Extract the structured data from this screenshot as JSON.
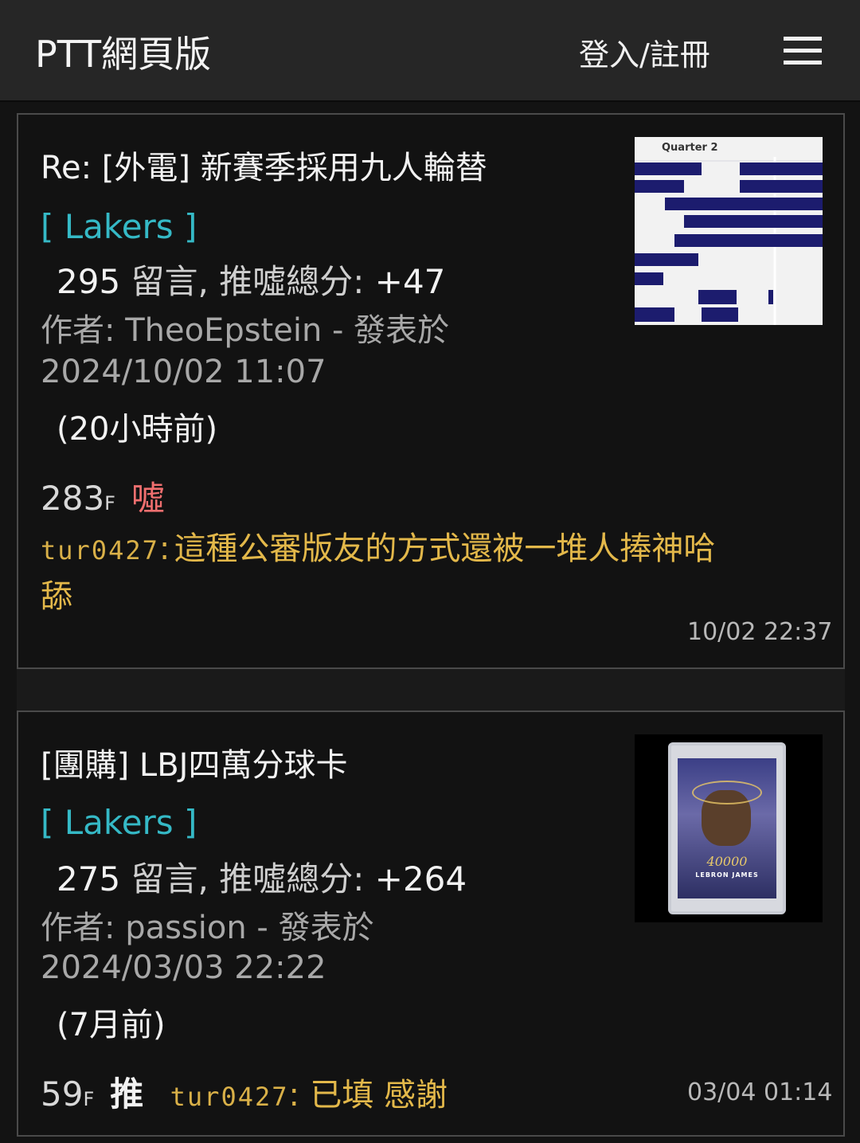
{
  "header": {
    "brand": "PTT網頁版",
    "login": "登入/註冊",
    "menu_icon": "hamburger-menu-icon"
  },
  "posts": [
    {
      "title": "Re: [外電] 新賽季採用九人輪替",
      "board": "[ Lakers ]",
      "comment_count": "295",
      "comments_label": "留言, 推噓總分:",
      "score": "+47",
      "author_line": "作者: TheoEpstein - 發表於",
      "posted_at": "2024/10/02 11:07",
      "ago": "(20小時前)",
      "thumbnail_caption": "Quarter 2",
      "top_comment": {
        "floor": "283",
        "floor_suffix": "F",
        "tag": "噓",
        "user": "tur0427",
        "colon": ":",
        "text_line1": "這種公審版友的方式還被一堆人捧神哈",
        "text_line2": "舔",
        "time": "10/02 22:37"
      }
    },
    {
      "title": "[團購] LBJ四萬分球卡",
      "board": "[ Lakers ]",
      "comment_count": "275",
      "comments_label": "留言, 推噓總分:",
      "score": "+264",
      "author_line": "作者: passion - 發表於",
      "posted_at": "2024/03/03 22:22",
      "ago": "(7月前)",
      "thumbnail_caption": "LEBRON JAMES",
      "thumbnail_number": "40000",
      "top_comment": {
        "floor": "59",
        "floor_suffix": "F",
        "tag": "推",
        "user": "tur0427",
        "colon": ":",
        "text_line1": "已填 感謝",
        "time": "03/04 01:14"
      }
    }
  ],
  "colors": {
    "board": "#35b9c6",
    "boo": "#ef6f6f",
    "comment_text": "#e3b84a",
    "chart_bar": "#1c1c6e"
  }
}
